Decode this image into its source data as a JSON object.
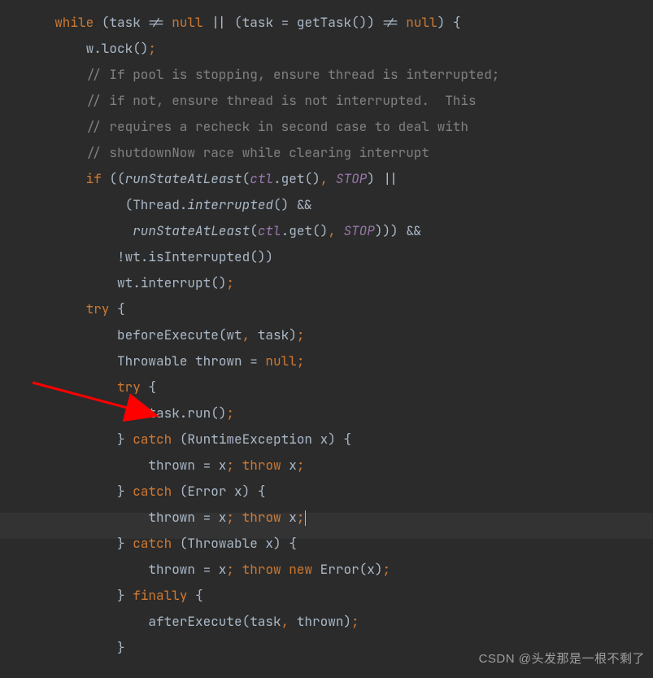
{
  "code": {
    "l1a": "while",
    "l1b": " (task != ",
    "l1c": "null",
    "l1d": " || (task = getTask()) != ",
    "l1e": "null",
    "l1f": ") {",
    "l2a": "w.lock()",
    "l2semi": ";",
    "l3": "// If pool is stopping, ensure thread is interrupted;",
    "l4": "// if not, ensure thread is not interrupted.  This",
    "l5": "// requires a recheck in second case to deal with",
    "l6": "// shutdownNow race while clearing interrupt",
    "l7a": "if",
    "l7b": " ((",
    "l7c": "runStateAtLeast",
    "l7d": "(",
    "l7e": "ctl",
    "l7f": ".get()",
    "l7g": ", ",
    "l7h": "STOP",
    "l7i": ") ||",
    "l8a": "(Thread.",
    "l8b": "interrupted",
    "l8c": "() &&",
    "l9a": "runStateAtLeast",
    "l9b": "(",
    "l9c": "ctl",
    "l9d": ".get()",
    "l9e": ", ",
    "l9f": "STOP",
    "l9g": "))) &&",
    "l10": "!wt.isInterrupted())",
    "l11a": "wt.interrupt()",
    "l11semi": ";",
    "l12a": "try",
    "l12b": " {",
    "l13a": "beforeExecute(wt",
    "l13b": ", ",
    "l13c": "task)",
    "l13semi": ";",
    "l14a": "Throwable thrown = ",
    "l14b": "null",
    "l14semi": ";",
    "l15a": "try",
    "l15b": " {",
    "l16a": "task.run()",
    "l16semi": ";",
    "l17a": "} ",
    "l17b": "catch",
    "l17c": " (RuntimeException x) {",
    "l18a": "thrown = x",
    "l18s1": ";",
    "l18sp": " ",
    "l18b": "throw",
    "l18c": " x",
    "l18s2": ";",
    "l19a": "} ",
    "l19b": "catch",
    "l19c": " (Error x) {",
    "l20a": "thrown = x",
    "l20s1": ";",
    "l20sp": " ",
    "l20b": "throw",
    "l20c": " x",
    "l20s2": ";",
    "l21a": "} ",
    "l21b": "catch",
    "l21c": " (Throwable x) {",
    "l22a": "thrown = x",
    "l22s1": ";",
    "l22sp": " ",
    "l22b": "throw",
    "l22c": " ",
    "l22d": "new",
    "l22e": " Error(x)",
    "l22s2": ";",
    "l23a": "} ",
    "l23b": "finally",
    "l23c": " {",
    "l24a": "afterExecute(task",
    "l24b": ", ",
    "l24c": "thrown)",
    "l24semi": ";",
    "l25": "}"
  },
  "watermark": "CSDN @头发那是一根不剩了",
  "colors": {
    "bg": "#2b2b2b",
    "keyword": "#cc7832",
    "comment": "#808080",
    "constant": "#9876aa",
    "text": "#a9b7c6",
    "arrow": "#ff0000"
  }
}
